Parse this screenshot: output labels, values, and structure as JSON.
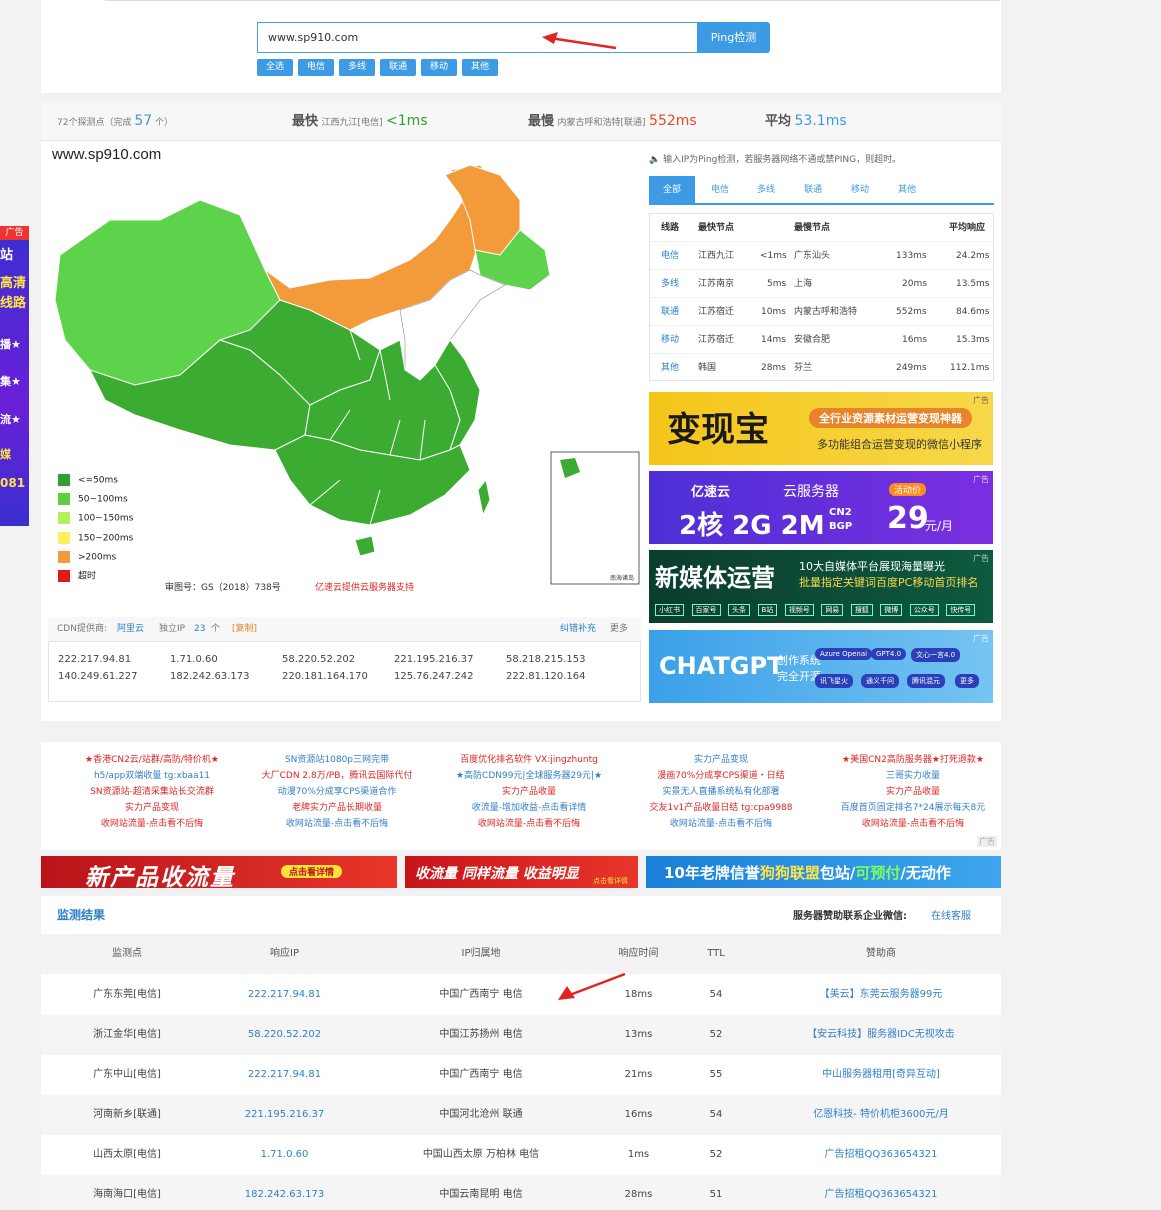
{
  "search": {
    "value": "www.sp910.com",
    "button": "Ping检测",
    "chips": [
      "全选",
      "电信",
      "多线",
      "联通",
      "移动",
      "其他"
    ]
  },
  "stats": {
    "nodes_prefix": "72个探测点（完成",
    "nodes_done": "57",
    "nodes_suffix": "个）",
    "fastest_label": "最快",
    "fastest_node": "江西九江[电信]",
    "fastest_value": "<1ms",
    "slowest_label": "最慢",
    "slowest_node": "内蒙古呼和浩特[联通]",
    "slowest_value": "552ms",
    "avg_label": "平均",
    "avg_value": "53.1ms"
  },
  "map": {
    "title": "www.sp910.com",
    "legend": [
      {
        "label": "<=50ms",
        "color": "#2ea12e"
      },
      {
        "label": "50~100ms",
        "color": "#5ad13f"
      },
      {
        "label": "100~150ms",
        "color": "#b3f05a"
      },
      {
        "label": "150~200ms",
        "color": "#ffef5a"
      },
      {
        "label": ">200ms",
        "color": "#f39b3a"
      },
      {
        "label": "超时",
        "color": "#e41a1a"
      }
    ],
    "review_no": "审图号：GS（2018）738号",
    "provider": "亿速云提供云服务器支持",
    "inset_label": "南海诸岛",
    "colors": {
      "dark_green": "#3cab32",
      "light_green": "#5cd34a",
      "orange": "#f39b3a",
      "white": "#ffffff"
    }
  },
  "panel": {
    "notice": "输入IP为Ping检测，若服务器网络不通或禁PING，则超时。",
    "tabs": [
      "全部",
      "电信",
      "多线",
      "联通",
      "移动",
      "其他"
    ],
    "headers": [
      "线路",
      "最快节点",
      "最慢节点",
      "平均响应"
    ],
    "rows": [
      {
        "line": "电信",
        "fast_node": "江西九江",
        "fast_ms": "<1ms",
        "slow_node": "广东汕头",
        "slow_ms": "133ms",
        "avg": "24.2ms"
      },
      {
        "line": "多线",
        "fast_node": "江苏南京",
        "fast_ms": "5ms",
        "slow_node": "上海",
        "slow_ms": "20ms",
        "avg": "13.5ms"
      },
      {
        "line": "联通",
        "fast_node": "江苏宿迁",
        "fast_ms": "10ms",
        "slow_node": "内蒙古呼和浩特",
        "slow_ms": "552ms",
        "avg": "84.6ms"
      },
      {
        "line": "移动",
        "fast_node": "江苏宿迁",
        "fast_ms": "14ms",
        "slow_node": "安徽合肥",
        "slow_ms": "16ms",
        "avg": "15.3ms"
      },
      {
        "line": "其他",
        "fast_node": "韩国",
        "fast_ms": "28ms",
        "slow_node": "芬兰",
        "slow_ms": "249ms",
        "avg": "112.1ms"
      }
    ]
  },
  "ads": {
    "ad_tag": "广告",
    "b1_title": "变现宝",
    "b1_line1": "全行业资源素材运营变现神器",
    "b1_line2": "多功能组合运营变现的微信小程序",
    "b2_brand": "亿速云",
    "b2_product": "云服务器",
    "b2_badge": "活动价",
    "b2_spec": "2核 2G 2M",
    "b2_cn2": "CN2",
    "b2_bgp": "BGP",
    "b2_price": "29",
    "b2_unit": "元/月",
    "b3_title": "新媒体运营",
    "b3_line1": "10大自媒体平台展现海量曝光",
    "b3_line2": "批量指定关键词百度PC移动首页排名",
    "b3_tags": [
      "小红书",
      "百家号",
      "头条",
      "B站",
      "视频号",
      "网易",
      "搜狐",
      "微博",
      "公众号",
      "快传号"
    ],
    "b4_title": "CHATGPT",
    "b4_sub1": "创作系统",
    "b4_sub2": "完全开源",
    "b4_tags": [
      "Azure Openai",
      "GPT4.0",
      "文心一言4.0",
      "讯飞星火",
      "通义千问",
      "腾讯混元",
      "更多"
    ],
    "left_tag": "广告",
    "left_lines": [
      "站",
      "高清",
      "线路",
      "播★",
      "集★",
      "流★",
      "媒",
      "081"
    ]
  },
  "cdn": {
    "provider_label": "CDN提供商:",
    "provider": "阿里云",
    "ip_label": "独立IP",
    "ip_count": "23",
    "ip_unit": "个",
    "copy": "[复制]",
    "report": "纠错补充",
    "more": "更多",
    "ips": [
      [
        "222.217.94.81",
        "1.71.0.60",
        "58.220.52.202",
        "221.195.216.37",
        "58.218.215.153"
      ],
      [
        "140.249.61.227",
        "182.242.63.173",
        "220.181.164.170",
        "125.76.247.242",
        "222.81.120.164"
      ]
    ]
  },
  "text_ads": [
    [
      "★香港CN2云/站群/高防/特价机★",
      "h5/app双端收量 tg:xbaa11",
      "SN资源站-超清采集站长交流群",
      "实力产品变现",
      "收网站流量-点击看不后悔"
    ],
    [
      "SN资源站1080p三网完带",
      "大厂CDN 2.8万/PB，腾讯云国际代付",
      "动漫70%分成享CPS渠道合作",
      "老牌实力产品长期收量",
      "收网站流量-点击看不后悔"
    ],
    [
      "百度优化排名软件 VX:jingzhuntg",
      "★高防CDN99元|全球服务器29元|★",
      "实力产品收量",
      "收流量-增加收益-点击看详情",
      "收网站流量-点击看不后悔"
    ],
    [
      "实力产品变现",
      "漫画70%分成享CPS渠道・日结",
      "实景无人直播系统私有化部署",
      "交友1v1产品收量日结 tg:cpa9988",
      "收网站流量-点击看不后悔"
    ],
    [
      "★美国CN2高防服务器★打死退款★",
      "三哥实力收量",
      "实力产品收量",
      "百度首页固定排名7*24展示每天8元",
      "收网站流量-点击看不后悔"
    ]
  ],
  "text_ads_tag": "广告",
  "image_banners": {
    "b1": "新产品收流量",
    "b1_btn": "点击看详情",
    "b2": "收流量 同样流量 收益明显",
    "b2_btn": "点击看详情",
    "b3_pre": "10年老牌信誉",
    "b3_brand": "狗狗联盟",
    "b3_mid": "包站/",
    "b3_green": "可预付",
    "b3_end": "/无动作"
  },
  "results": {
    "title": "监测结果",
    "sponsor_label": "服务器赞助联系企业微信:",
    "sponsor_link": "在线客服",
    "headers": [
      "监测点",
      "响应IP",
      "IP归属地",
      "响应时间",
      "TTL",
      "赞助商"
    ],
    "rows": [
      {
        "node": "广东东莞[电信]",
        "ip": "222.217.94.81",
        "loc": "中国广西南宁 电信",
        "time": "18ms",
        "ttl": "54",
        "sponsor": "【美云】东莞云服务器99元"
      },
      {
        "node": "浙江金华[电信]",
        "ip": "58.220.52.202",
        "loc": "中国江苏扬州 电信",
        "time": "13ms",
        "ttl": "52",
        "sponsor": "【安云科技】服务器IDC无视攻击"
      },
      {
        "node": "广东中山[电信]",
        "ip": "222.217.94.81",
        "loc": "中国广西南宁 电信",
        "time": "21ms",
        "ttl": "55",
        "sponsor": "中山服务器租用[奇异互动]"
      },
      {
        "node": "河南新乡[联通]",
        "ip": "221.195.216.37",
        "loc": "中国河北沧州 联通",
        "time": "16ms",
        "ttl": "54",
        "sponsor": "亿恩科技- 特价机柜3600元/月"
      },
      {
        "node": "山西太原[电信]",
        "ip": "1.71.0.60",
        "loc": "中国山西太原 万柏林 电信",
        "time": "1ms",
        "ttl": "52",
        "sponsor": "广告招租QQ363654321"
      },
      {
        "node": "海南海口[电信]",
        "ip": "182.242.63.173",
        "loc": "中国云南昆明 电信",
        "time": "28ms",
        "ttl": "51",
        "sponsor": "广告招租QQ363654321"
      }
    ]
  }
}
